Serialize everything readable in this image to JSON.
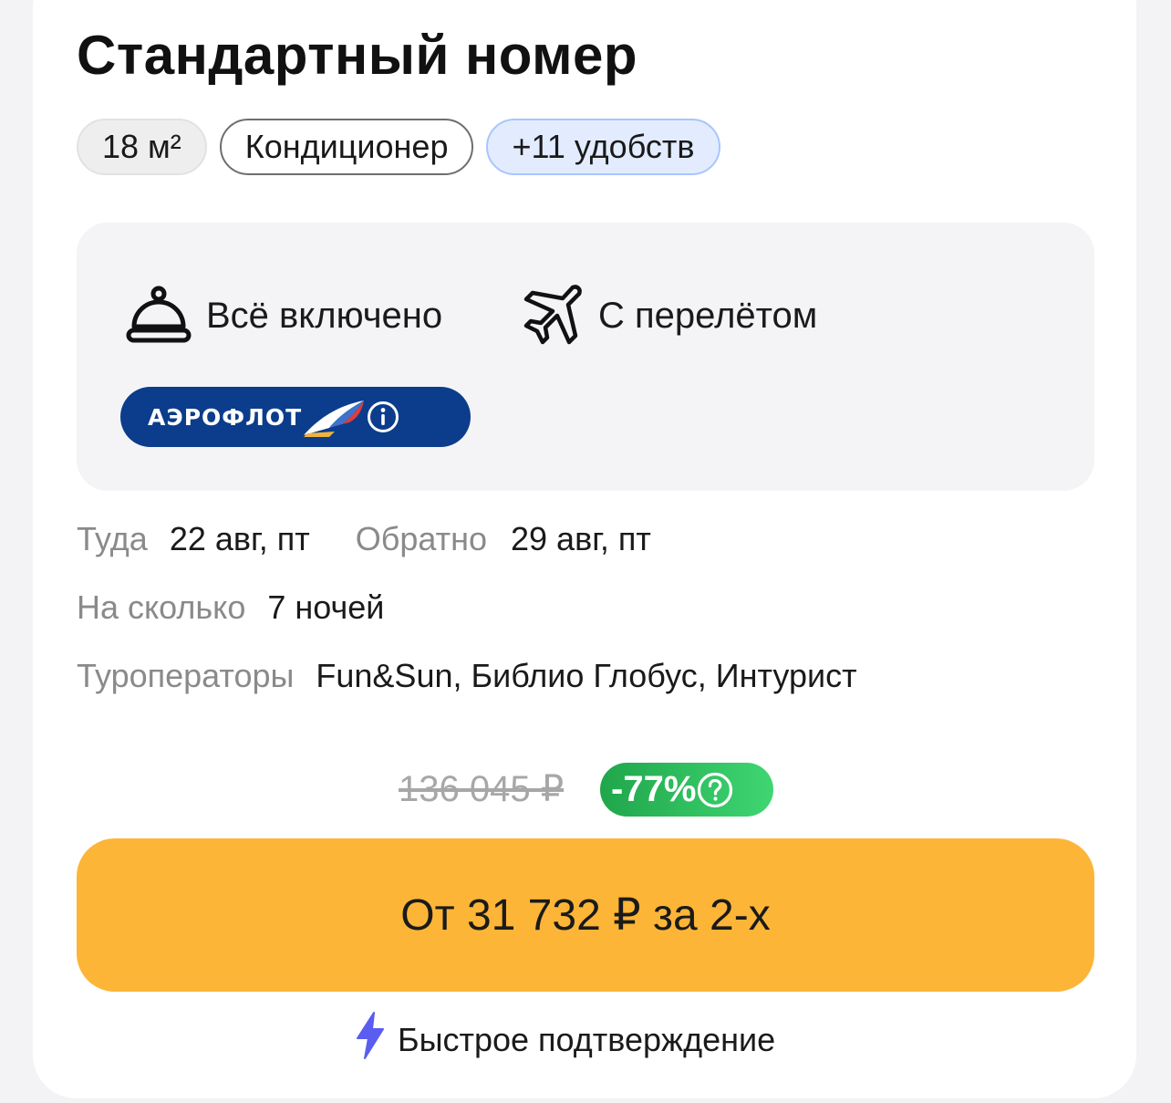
{
  "room": {
    "title": "Стандартный номер",
    "chips": {
      "area": "18 м²",
      "ac": "Кондиционер",
      "more": "+11 удобств"
    }
  },
  "features": {
    "meal": "Всё включено",
    "flight": "С перелётом",
    "meal_icon": "cloche-icon",
    "flight_icon": "airplane-icon"
  },
  "airline": {
    "name": "АЭРОФЛОТ",
    "color": "#0b3d8c"
  },
  "details": {
    "there_label": "Туда",
    "there_value": "22 авг, пт",
    "back_label": "Обратно",
    "back_value": "29 авг, пт",
    "nights_label": "На сколько",
    "nights_value": "7 ночей",
    "operators_label": "Туроператоры",
    "operators_value": "Fun&Sun, Библио Глобус, Интурист"
  },
  "price": {
    "old": "136 045 ₽",
    "discount": "-77%",
    "button": "От 31 732 ₽ за 2-х",
    "button_color": "#fdb537",
    "discount_color": "#20a64b"
  },
  "fast_confirm": {
    "label": "Быстрое подтверждение",
    "icon": "lightning-icon",
    "icon_color": "#5b5cf0"
  }
}
